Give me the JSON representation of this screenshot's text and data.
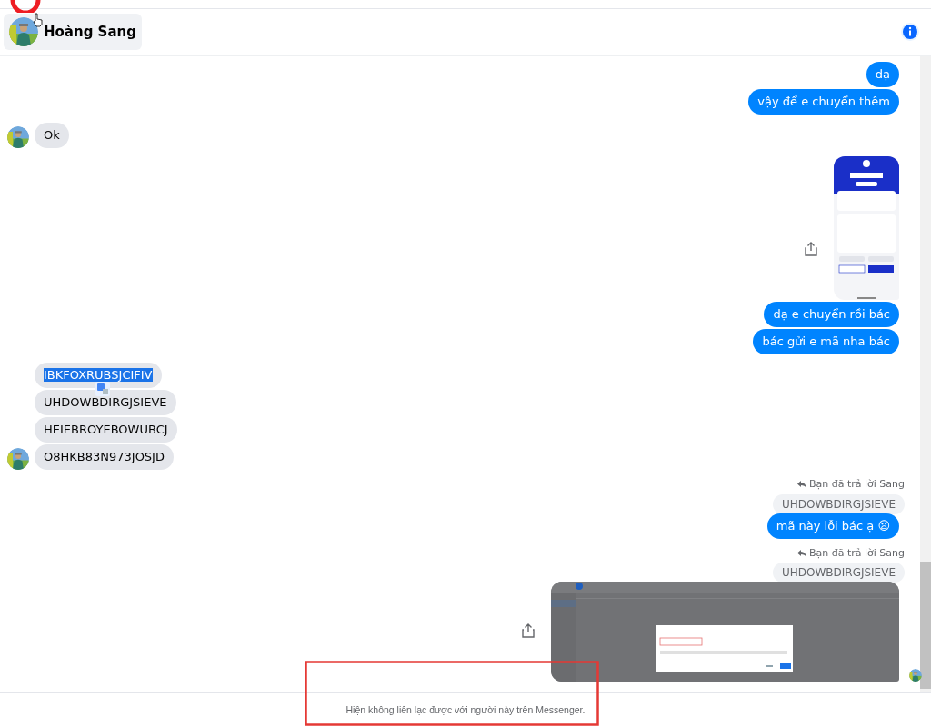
{
  "header": {
    "contact_name": "Hoàng Sang"
  },
  "messages": [
    {
      "kind": "text",
      "outgoing": true,
      "text": "dạ",
      "highlighted": false,
      "avatar": false
    },
    {
      "kind": "text",
      "outgoing": true,
      "text": "vậy để e chuyển thêm",
      "highlighted": false,
      "avatar": false
    },
    {
      "kind": "text",
      "outgoing": false,
      "text": "Ok",
      "highlighted": false,
      "avatar": true
    },
    {
      "kind": "receipt",
      "outgoing": true,
      "avatar": false
    },
    {
      "kind": "text",
      "outgoing": true,
      "text": "dạ e chuyển rồi bác",
      "highlighted": false,
      "avatar": false
    },
    {
      "kind": "text",
      "outgoing": true,
      "text": "bác gửi e mã nha bác",
      "highlighted": false,
      "avatar": false
    },
    {
      "kind": "text",
      "outgoing": false,
      "text": "IBKFOXRUBSJCIFIV",
      "highlighted": true,
      "avatar": false
    },
    {
      "kind": "text",
      "outgoing": false,
      "text": "UHDOWBDIRGJSIEVE",
      "highlighted": false,
      "avatar": false
    },
    {
      "kind": "text",
      "outgoing": false,
      "text": "HEIEBROYEBOWUBCJ",
      "highlighted": false,
      "avatar": false
    },
    {
      "kind": "text",
      "outgoing": false,
      "text": "O8HKB83N973JOSJD",
      "highlighted": false,
      "avatar": true
    },
    {
      "kind": "reply",
      "label": "Bạn đã trả lời Sang",
      "quote": "UHDOWBDIRGJSIEVE"
    },
    {
      "kind": "text",
      "outgoing": true,
      "text": "mã này lỗi bác ạ 😦",
      "highlighted": false,
      "avatar": false
    },
    {
      "kind": "reply",
      "label": "Bạn đã trả lời Sang",
      "quote": "UHDOWBDIRGJSIEVE"
    },
    {
      "kind": "dialog",
      "outgoing": true,
      "avatar": true
    }
  ],
  "footer": {
    "notice": "Hiện không liên lạc được với người này trên Messenger."
  }
}
